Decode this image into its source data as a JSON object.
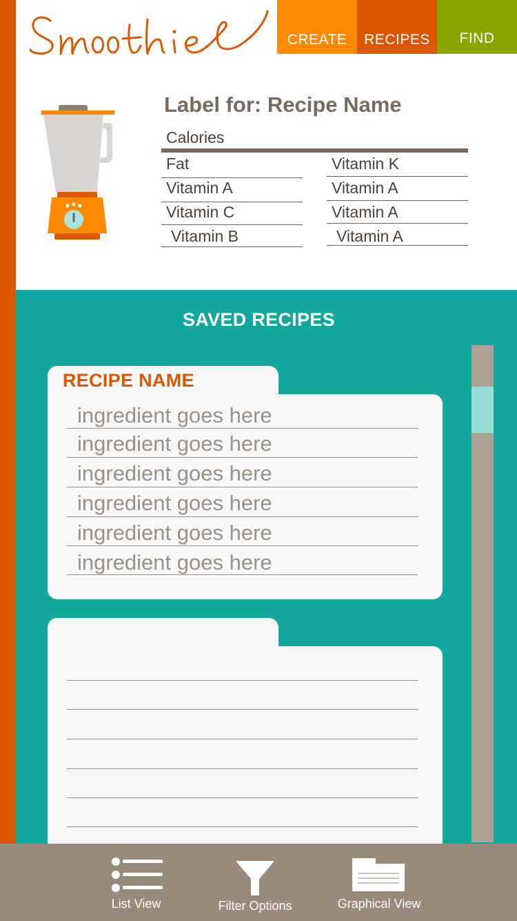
{
  "app": {
    "logo_text": "Smoothies"
  },
  "nav": {
    "create": "CREATE",
    "recipes": "RECIPES",
    "find": "FIND"
  },
  "label": {
    "title": "Label for: Recipe Name",
    "calories": "Calories",
    "left": [
      "Fat",
      "Vitamin A",
      "Vitamin C",
      "Vitamin B"
    ],
    "right": [
      "Vitamin K",
      "Vitamin A",
      "Vitamin A",
      "Vitamin A"
    ]
  },
  "saved": {
    "title": "SAVED RECIPES",
    "cards": [
      {
        "name": "RECIPE NAME",
        "ingredients": [
          "ingredient goes here",
          "ingredient goes here",
          "ingredient goes here",
          "ingredient goes here",
          "ingredient goes here",
          "ingredient goes here"
        ]
      }
    ]
  },
  "toolbar": {
    "list": "List View",
    "filter": "Filter Options",
    "graph": "Graphical View"
  },
  "colors": {
    "orange_dark": "#db5800",
    "orange": "#ff8a00",
    "green": "#8aa400",
    "teal": "#13a89d",
    "taupe": "#988b7b",
    "text_brown": "#7a6a5d"
  }
}
